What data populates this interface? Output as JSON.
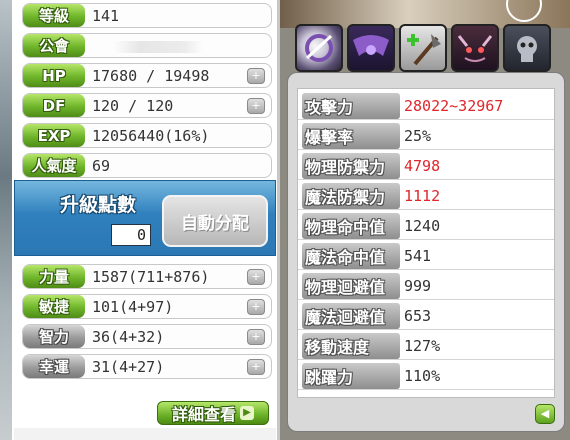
{
  "char_info": {
    "rows": [
      {
        "label": "等級",
        "value": "141"
      },
      {
        "label": "公會",
        "value": ""
      },
      {
        "label": "HP",
        "value": "17680 / 19498"
      },
      {
        "label": "DF",
        "value": "120 / 120"
      },
      {
        "label": "EXP",
        "value": "12056440(16%)"
      },
      {
        "label": "人氣度",
        "value": "69"
      }
    ]
  },
  "ability_points": {
    "title": "升級點數",
    "value": "0",
    "auto_assign_label": "自動分配"
  },
  "base_stats": [
    {
      "label": "力量",
      "value": "1587(711+876)"
    },
    {
      "label": "敏捷",
      "value": "101(4+97)"
    },
    {
      "label": "智力",
      "value": "36(4+32)"
    },
    {
      "label": "幸運",
      "value": "31(4+27)"
    }
  ],
  "detail_button_label": "詳細查看",
  "skill_icons": [
    "ring-slash-icon",
    "dark-wing-icon",
    "plus-axe-icon",
    "demon-face-icon",
    "skull-icon"
  ],
  "detail_stats": [
    {
      "label": "攻擊力",
      "value": "28022~32967",
      "highlight": true
    },
    {
      "label": "爆擊率",
      "value": "25%",
      "highlight": false
    },
    {
      "label": "物理防禦力",
      "value": "4798",
      "highlight": true
    },
    {
      "label": "魔法防禦力",
      "value": "1112",
      "highlight": true
    },
    {
      "label": "物理命中值",
      "value": "1240",
      "highlight": false
    },
    {
      "label": "魔法命中值",
      "value": "541",
      "highlight": false
    },
    {
      "label": "物理迴避值",
      "value": "999",
      "highlight": false
    },
    {
      "label": "魔法迴避值",
      "value": "653",
      "highlight": false
    },
    {
      "label": "移動速度",
      "value": "127%",
      "highlight": false
    },
    {
      "label": "跳躍力",
      "value": "110%",
      "highlight": false
    }
  ],
  "colors": {
    "accent_green": "#6fb52a",
    "ap_blue": "#2f80bd",
    "highlight_red": "#e0262b"
  }
}
